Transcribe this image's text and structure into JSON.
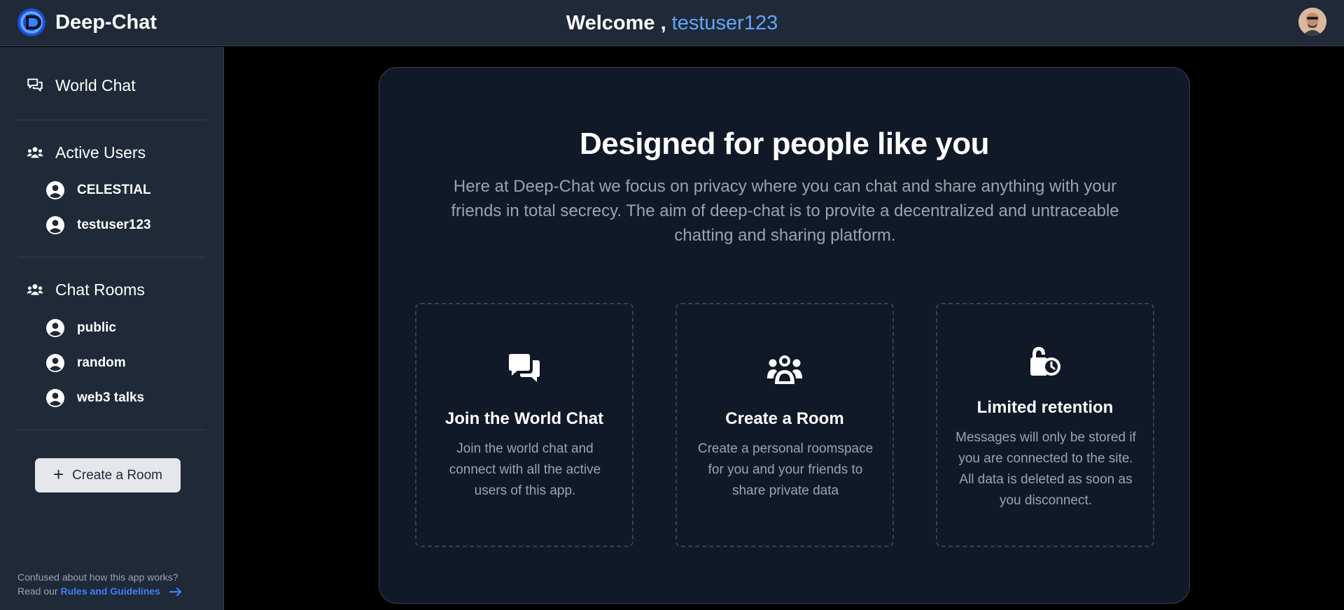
{
  "header": {
    "brand": "Deep-Chat",
    "welcome_prefix": "Welcome ,",
    "username": "testuser123",
    "accent_color": "#60a5fa"
  },
  "sidebar": {
    "world_chat": "World Chat",
    "active_users": {
      "title": "Active Users",
      "users": [
        "CELESTIAL",
        "testuser123"
      ]
    },
    "chat_rooms": {
      "title": "Chat Rooms",
      "rooms": [
        "public",
        "random",
        "web3 talks"
      ]
    },
    "create_room_button": "Create a Room",
    "help": {
      "line1": "Confused about how this app works?",
      "line2_prefix": "Read our",
      "link": "Rules and Guidelines"
    }
  },
  "main": {
    "heading": "Designed for people like you",
    "intro": "Here at Deep-Chat we focus on privacy where you can chat and share anything with your friends in total secrecy. The aim of deep-chat is to provite a decentralized and untraceable chatting and sharing platform.",
    "features": [
      {
        "icon": "chat-bubbles-icon",
        "title": "Join the World Chat",
        "description": "Join the world chat and connect with all the active users of this app."
      },
      {
        "icon": "users-group-icon",
        "title": "Create a Room",
        "description": "Create a personal roomspace for you and your friends to share private data"
      },
      {
        "icon": "unlock-timer-icon",
        "title": "Limited retention",
        "description": "Messages will only be stored if you are connected to the site. All data is deleted as soon as you disconnect."
      }
    ]
  }
}
